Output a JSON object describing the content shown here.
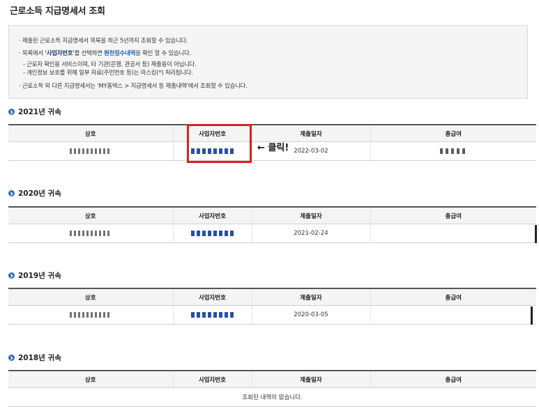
{
  "page_title": "근로소득 지급명세서 조회",
  "info": {
    "line1": "· 제출된 근로소득 지급명세서 목록을 최근 5년까지 조회할 수 있습니다.",
    "line2_pre": "· 목록에서 ",
    "line2_hl1": "'사업자번호'",
    "line2_mid": "를 선택하면 ",
    "line2_hl2": "원천징수내역",
    "line2_post": "을 확인 할 수 있습니다.",
    "sub1": "- 근로자 확인용 서비스이며, 타 기관(은행, 관공서 등) 제출용이 아닙니다.",
    "sub2": "- 개인정보 보호를 위해 일부 자료(주민번호 등)는 마스킹(*) 처리됩니다.",
    "line3": "· 근로소득 외 다른 지급명세서는 'MY홈택스 > 지급명세서 등 제출내역'에서 조회할 수 있습니다."
  },
  "columns": [
    "상호",
    "사업자번호",
    "제출일자",
    "총급여"
  ],
  "years": [
    {
      "heading": "2021년 귀속",
      "rows": [
        {
          "submit_date": "2022-03-02"
        }
      ]
    },
    {
      "heading": "2020년 귀속",
      "rows": [
        {
          "submit_date": "2021-02-24"
        }
      ]
    },
    {
      "heading": "2019년 귀속",
      "rows": [
        {
          "submit_date": "2020-03-05"
        }
      ]
    },
    {
      "heading": "2018년 귀속",
      "rows": [],
      "empty_message": "조회된 내역이 없습니다."
    }
  ],
  "annotation": {
    "click_label": "← 클릭!",
    "highlight_color": "#e02020"
  },
  "colors": {
    "accent": "#2f66b3",
    "link": "#1a5fb4"
  }
}
